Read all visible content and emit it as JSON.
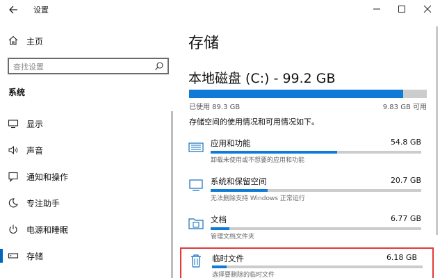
{
  "window": {
    "title": "设置"
  },
  "nav": {
    "home_label": "主页",
    "search_placeholder": "查找设置",
    "section_label": "系统",
    "items": [
      {
        "label": "显示",
        "icon": "monitor-icon"
      },
      {
        "label": "声音",
        "icon": "speaker-icon"
      },
      {
        "label": "通知和操作",
        "icon": "notification-icon"
      },
      {
        "label": "专注助手",
        "icon": "moon-icon"
      },
      {
        "label": "电源和睡眠",
        "icon": "power-icon"
      },
      {
        "label": "存储",
        "icon": "storage-icon",
        "active": true
      }
    ]
  },
  "main": {
    "title": "存储",
    "disk_title": "本地磁盘 (C:) - 99.2 GB",
    "used_label": "已使用 89.3 GB",
    "free_label": "9.83 GB 可用",
    "used_fraction": 0.9,
    "description": "存储空间的使用情况和可用情况如下。",
    "categories": [
      {
        "name": "应用和功能",
        "size": "54.8 GB",
        "desc": "卸载未使用或不想要的应用和功能",
        "fraction": 0.6,
        "icon": "apps-icon"
      },
      {
        "name": "系统和保留空间",
        "size": "20.7 GB",
        "desc": "无法删除支持 Windows 正常运行",
        "fraction": 0.27,
        "icon": "system-icon"
      },
      {
        "name": "文档",
        "size": "6.77 GB",
        "desc": "管理文档文件夹",
        "fraction": 0.09,
        "icon": "documents-icon"
      },
      {
        "name": "临时文件",
        "size": "6.18 GB",
        "desc": "选择要删除的临时文件",
        "fraction": 0.07,
        "icon": "trash-icon"
      }
    ]
  },
  "colors": {
    "accent": "#0f7bd6",
    "highlight_border": "#e03a3a"
  }
}
